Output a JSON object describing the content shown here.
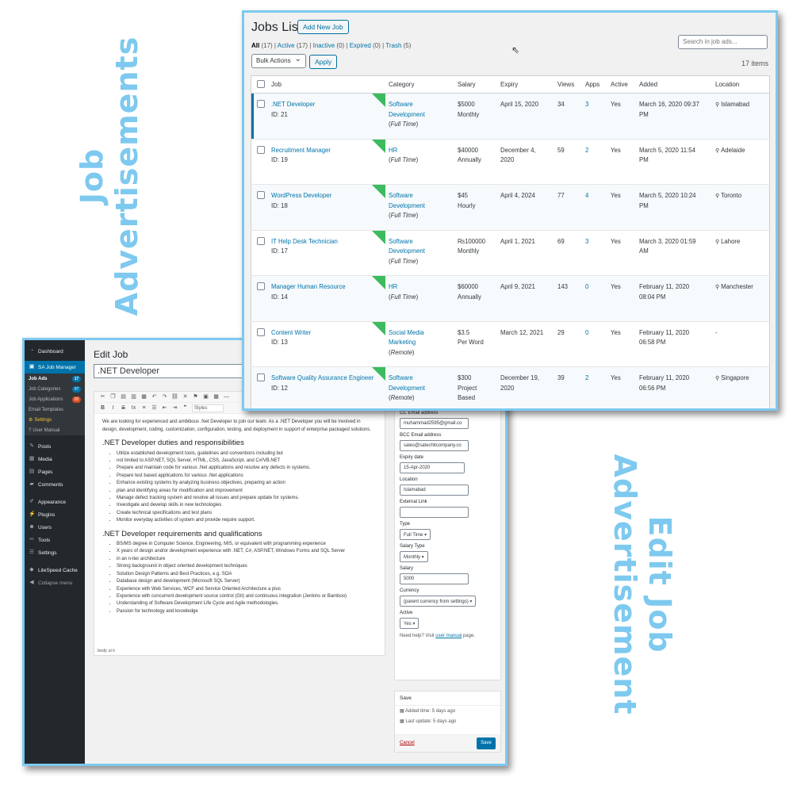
{
  "captions": {
    "left_line1": "Job",
    "left_line2": "Advertisements",
    "right_line1": "Edit Job",
    "right_line2": "Advertisement"
  },
  "jobs_list": {
    "title": "Jobs List",
    "add_new": "Add New Job",
    "filters": {
      "all": "All",
      "all_count": "(17)",
      "active": "Active",
      "active_count": "(17)",
      "inactive": "Inactive",
      "inactive_count": "(0)",
      "expired": "Expired",
      "expired_count": "(0)",
      "trash": "Trash",
      "trash_count": "(5)"
    },
    "search_placeholder": "Search in job ads...",
    "bulk_actions": "Bulk Actions",
    "apply": "Apply",
    "items_count": "17 items",
    "columns": [
      "Job",
      "Category",
      "Salary",
      "Expiry",
      "Views",
      "Apps",
      "Active",
      "Added",
      "Location"
    ],
    "rows": [
      {
        "title": ".NET Developer",
        "id": "ID: 21",
        "cat1": "Software",
        "cat2": "Development",
        "type": "Full Time",
        "salary1": "$5000",
        "salary2": "Monthly",
        "salary3": "",
        "expiry1": "April 15, 2020",
        "expiry2": "",
        "views": "34",
        "apps": "3",
        "active": "Yes",
        "added1": "March 16, 2020 09:37",
        "added2": "PM",
        "location": "Islamabad"
      },
      {
        "title": "Recruitment Manager",
        "id": "ID: 19",
        "cat1": "HR",
        "cat2": "",
        "type": "Full Time",
        "salary1": "$40000",
        "salary2": "Annually",
        "salary3": "",
        "expiry1": "December 4,",
        "expiry2": "2020",
        "views": "59",
        "apps": "2",
        "active": "Yes",
        "added1": "March 5, 2020 11:54",
        "added2": "PM",
        "location": "Adelaide"
      },
      {
        "title": "WordPress Developer",
        "id": "ID: 18",
        "cat1": "Software",
        "cat2": "Development",
        "type": "Full Time",
        "salary1": "$45",
        "salary2": "Hourly",
        "salary3": "",
        "expiry1": "April 4, 2024",
        "expiry2": "",
        "views": "77",
        "apps": "4",
        "active": "Yes",
        "added1": "March 5, 2020 10:24",
        "added2": "PM",
        "location": "Toronto"
      },
      {
        "title": "IT Help Desk Technician",
        "id": "ID: 17",
        "cat1": "Software",
        "cat2": "Development",
        "type": "Full Time",
        "salary1": "₨100000",
        "salary2": "Monthly",
        "salary3": "",
        "expiry1": "April 1, 2021",
        "expiry2": "",
        "views": "69",
        "apps": "3",
        "active": "Yes",
        "added1": "March 3, 2020 01:59",
        "added2": "AM",
        "location": "Lahore"
      },
      {
        "title": "Manager Human Resource",
        "id": "ID: 14",
        "cat1": "HR",
        "cat2": "",
        "type": "Full Time",
        "salary1": "$60000",
        "salary2": "Annually",
        "salary3": "",
        "expiry1": "April 9, 2021",
        "expiry2": "",
        "views": "143",
        "apps": "0",
        "active": "Yes",
        "added1": "February 11, 2020",
        "added2": "08:04 PM",
        "location": "Manchester"
      },
      {
        "title": "Content Writer",
        "id": "ID: 13",
        "cat1": "Social Media",
        "cat2": "Marketing",
        "type": "Remote",
        "salary1": "$3.5",
        "salary2": "Per Word",
        "salary3": "",
        "expiry1": "March 12, 2021",
        "expiry2": "",
        "views": "29",
        "apps": "0",
        "active": "Yes",
        "added1": "February 11, 2020",
        "added2": "06:58 PM",
        "location": "-"
      },
      {
        "title": "Software Quality Assurance Engineer",
        "id": "ID: 12",
        "cat1": "Software",
        "cat2": "Development",
        "type": "Remote",
        "salary1": "$300",
        "salary2": "Project",
        "salary3": "Based",
        "expiry1": "December 19,",
        "expiry2": "2020",
        "views": "39",
        "apps": "2",
        "active": "Yes",
        "added1": "February 11, 2020",
        "added2": "06:56 PM",
        "location": "Singapore"
      }
    ]
  },
  "sidebar": {
    "dashboard": "Dashboard",
    "plugin": "SA Job Manager",
    "sub": {
      "job_ads": "Job Ads",
      "job_ads_badge": "17",
      "job_categories": "Job Categories",
      "job_categories_badge": "07",
      "job_applications": "Job Applications",
      "job_applications_badge": "02",
      "email_templates": "Email Templates",
      "settings": "Settings",
      "user_manual": "User Manual"
    },
    "posts": "Posts",
    "media": "Media",
    "pages": "Pages",
    "comments": "Comments",
    "appearance": "Appearance",
    "plugins": "Plugins",
    "users": "Users",
    "tools": "Tools",
    "settings": "Settings",
    "litespeed": "LiteSpeed Cache",
    "collapse": "Collapse menu"
  },
  "edit_job": {
    "heading": "Edit Job",
    "title_value": ".NET Developer",
    "toolbar_styles": "Styles",
    "intro": "We are looking for experienced and ambitious .Net Developer to join our team. As a .NET Developer you will be involved in design, development, coding, customization, configuration, testing, and deployment in support of enterprise packaged solutions.",
    "h_duties": ".NET Developer duties and responsibilities",
    "duties": [
      "Utilize established development tools, guidelines and conventions including but",
      "not limited to ASP.NET, SQL Server, HTML, CSS, JavaScript, and C#/VB.NET",
      "Prepare and maintain code for various .Net applications and resolve any defects in systems.",
      "Prepare test based applications for various .Net applications",
      "Enhance existing systems by analyzing business objectives, preparing an action",
      "plan and identifying areas for modification and improvement",
      "Manage defect tracking system and resolve all issues and prepare update for systems.",
      "Investigate and develop skills in new technologies",
      "Create technical specifications and test plans",
      "Monitor everyday activities of system and provide require support."
    ],
    "h_requirements": ".NET Developer requirements and qualifications",
    "requirements": [
      "BS/MS degree in Computer Science, Engineering, MIS, or equivalent with programming experience",
      "X years of design and/or development experience with .NET, C#, ASP.NET, Windows Forms and SQL Server",
      "in an n-tier architecture",
      "Strong background in object oriented development techniques",
      "Solution Design Patterns and Best Practices, e.g. SOA",
      "Database design and development (Microsoft SQL Server)",
      "Experience with Web Services, WCF and Service Oriented Architecture a plus",
      "Experience with concurrent development source control (Git) and continuous integration (Jenkins or Bamboo)",
      "Understanding of Software Development Life Cycle and Agile methodologies.",
      "Passion for technology and knowledge"
    ],
    "status_path": "body   ul   li",
    "meta": {
      "cc_label": "CC Email address",
      "cc_value": "muhammad2595@gmail.co",
      "bcc_label": "BCC Email address",
      "bcc_value": "sales@satechitcompany.co",
      "expiry_label": "Expiry date",
      "expiry_value": "15-Apr-2020",
      "location_label": "Location",
      "location_value": "Islamabad",
      "external_label": "External Link",
      "external_value": "",
      "type_label": "Type",
      "type_value": "Full Time",
      "salary_type_label": "Salary Type",
      "salary_type_value": "Monthly",
      "salary_label": "Salary",
      "salary_value": "5000",
      "currency_label": "Currency",
      "currency_value": "(parent currency from settings)",
      "active_label": "Active",
      "active_value": "Yes",
      "help_prefix": "Need help? Visit",
      "help_link": "user manual",
      "help_suffix": "page."
    },
    "save": {
      "heading": "Save",
      "added": "Added time: 5 days ago",
      "updated": "Last update: 5 days ago",
      "cancel": "Cancel",
      "save_btn": "Save"
    }
  },
  "colors": {
    "accent": "#7ec9ef",
    "wp_blue": "#0073aa",
    "flag_green": "#3dbb5f",
    "sidebar_bg": "#23282d"
  }
}
